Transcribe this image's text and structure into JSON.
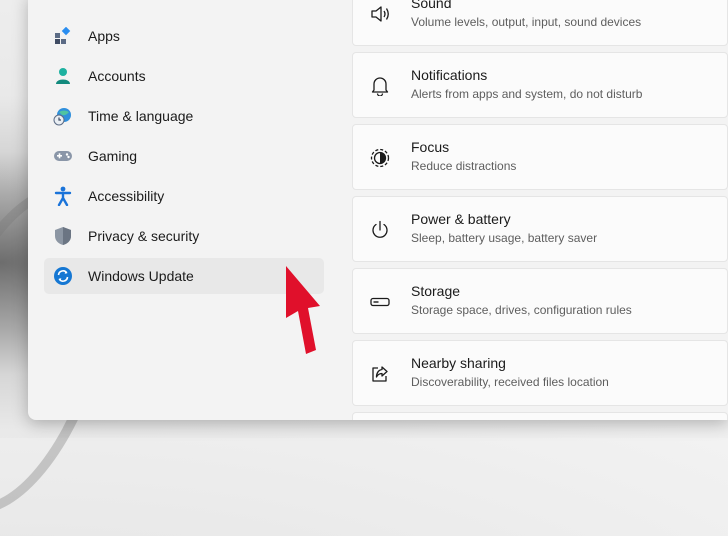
{
  "sidebar": {
    "items": [
      {
        "label": "Apps",
        "icon": "apps-icon"
      },
      {
        "label": "Accounts",
        "icon": "accounts-icon"
      },
      {
        "label": "Time & language",
        "icon": "time-language-icon"
      },
      {
        "label": "Gaming",
        "icon": "gaming-icon"
      },
      {
        "label": "Accessibility",
        "icon": "accessibility-icon"
      },
      {
        "label": "Privacy & security",
        "icon": "shield-icon"
      },
      {
        "label": "Windows Update",
        "icon": "windows-update-icon",
        "selected": true
      }
    ]
  },
  "main": {
    "cards": [
      {
        "title": "Sound",
        "subtitle": "Volume levels, output, input, sound devices",
        "icon": "speaker-icon"
      },
      {
        "title": "Notifications",
        "subtitle": "Alerts from apps and system, do not disturb",
        "icon": "bell-icon"
      },
      {
        "title": "Focus",
        "subtitle": "Reduce distractions",
        "icon": "focus-icon"
      },
      {
        "title": "Power & battery",
        "subtitle": "Sleep, battery usage, battery saver",
        "icon": "power-icon"
      },
      {
        "title": "Storage",
        "subtitle": "Storage space, drives, configuration rules",
        "icon": "storage-icon"
      },
      {
        "title": "Nearby sharing",
        "subtitle": "Discoverability, received files location",
        "icon": "share-icon"
      }
    ]
  },
  "colors": {
    "accent": "#0067c0",
    "annotation_arrow": "#e0102b",
    "selected_bg": "#e8e8e8"
  }
}
